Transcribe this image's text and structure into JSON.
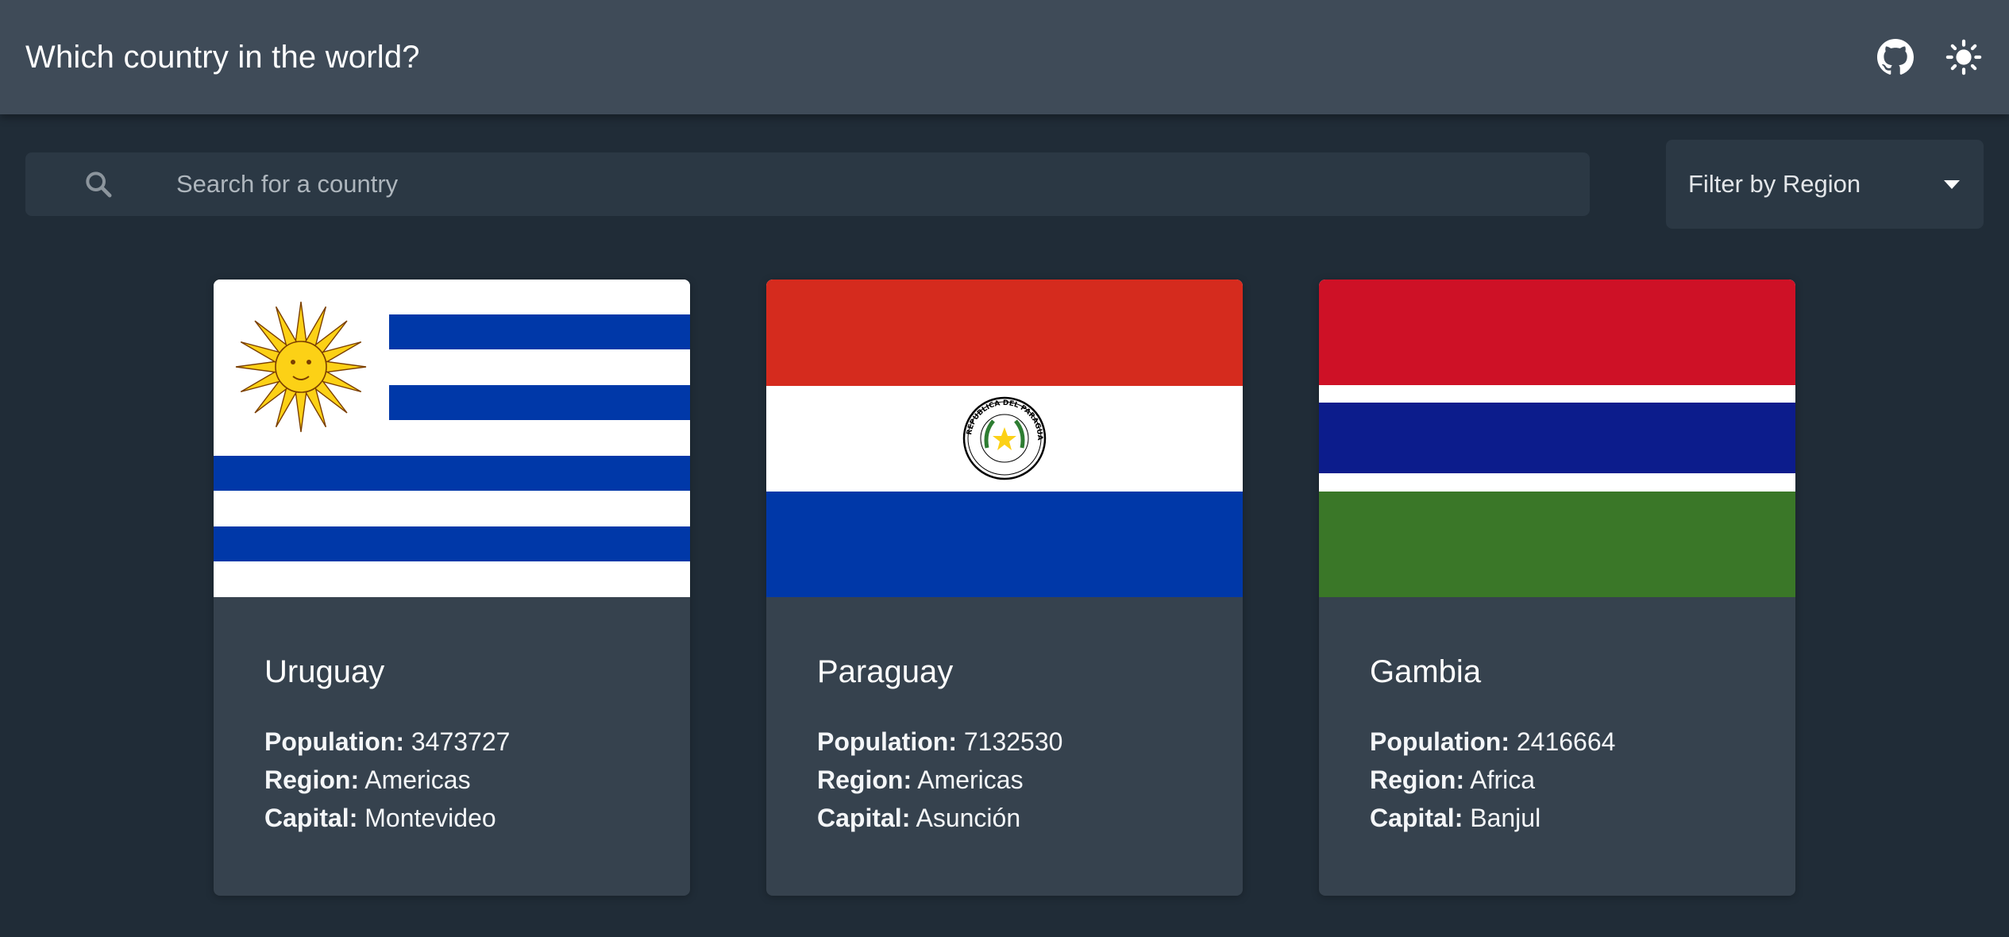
{
  "header": {
    "title": "Which country in the world?",
    "github_icon": "github-icon",
    "theme_icon": "sun-icon"
  },
  "search": {
    "placeholder": "Search for a country",
    "value": "",
    "icon": "search-icon"
  },
  "filter": {
    "label": "Filter by Region",
    "icon": "chevron-down-icon"
  },
  "labels": {
    "population": "Population:",
    "region": "Region:",
    "capital": "Capital:"
  },
  "countries": [
    {
      "name": "Uruguay",
      "population": "3473727",
      "region": "Americas",
      "capital": "Montevideo",
      "flag": "uruguay-flag"
    },
    {
      "name": "Paraguay",
      "population": "7132530",
      "region": "Americas",
      "capital": "Asunción",
      "flag": "paraguay-flag",
      "flag_text": "REPÚBLICA DEL PARAGUAY"
    },
    {
      "name": "Gambia",
      "population": "2416664",
      "region": "Africa",
      "capital": "Banjul",
      "flag": "gambia-flag"
    }
  ],
  "colors": {
    "background": "#202c37",
    "header": "#3f4b58",
    "card": "#36424e",
    "input": "#2b3844"
  }
}
